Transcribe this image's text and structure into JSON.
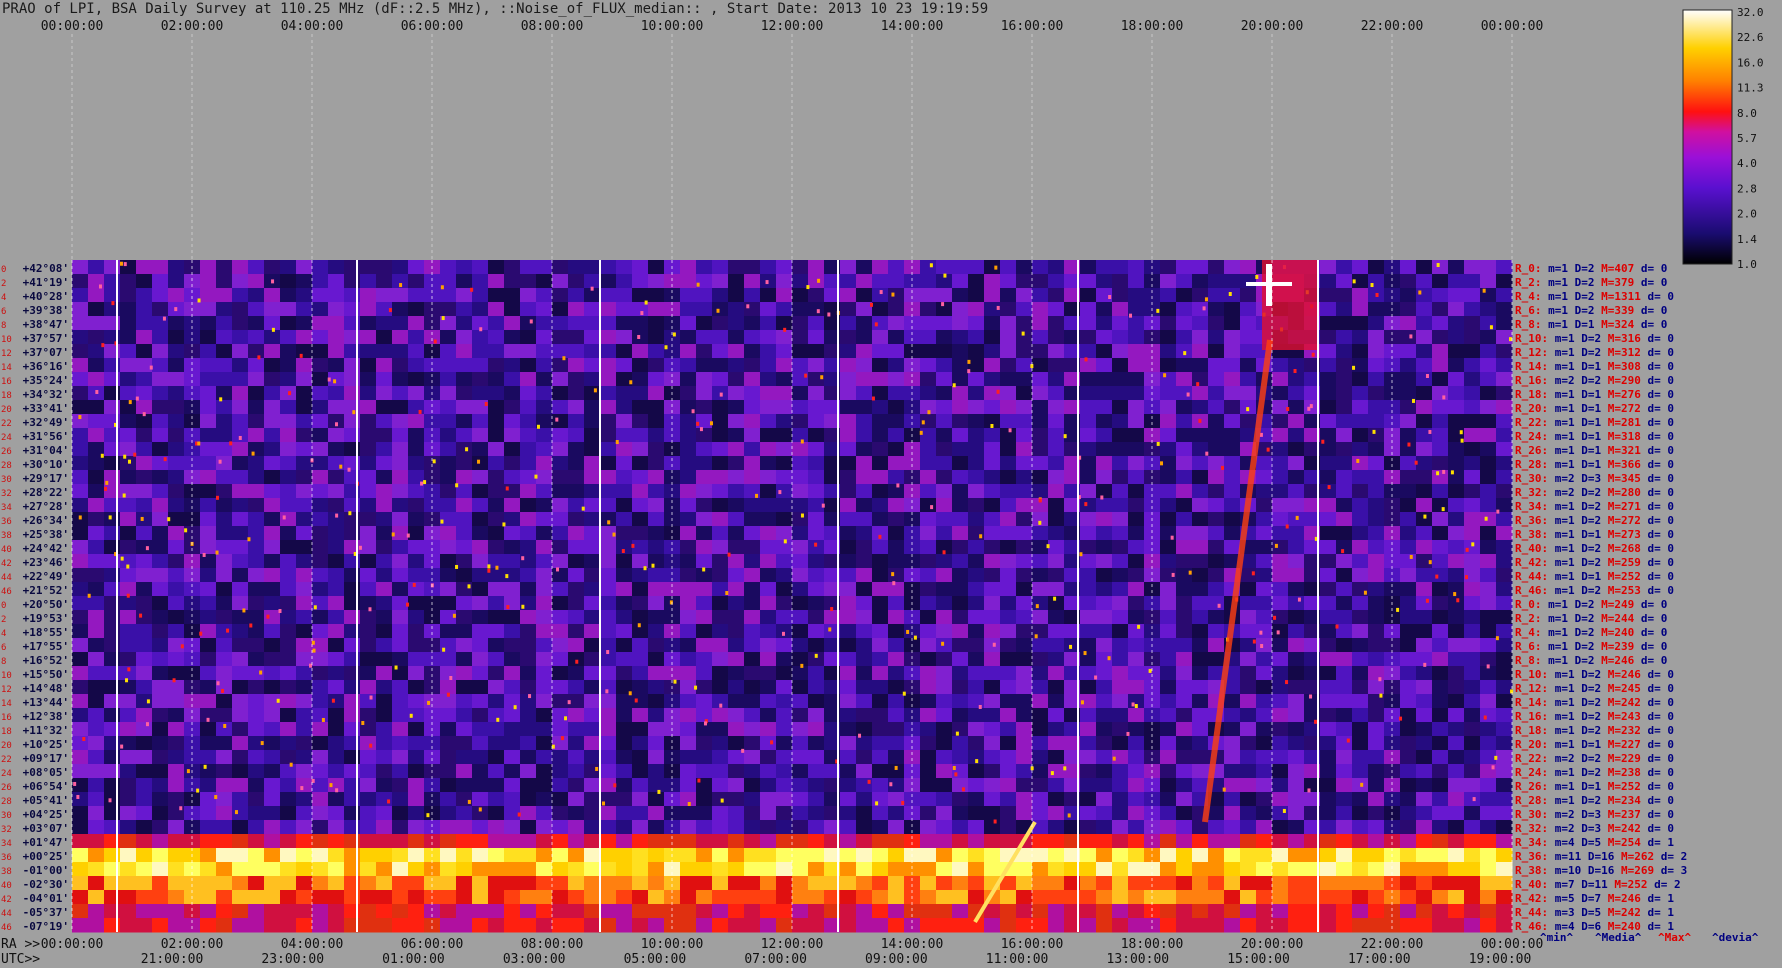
{
  "title": "PRAO of LPI, BSA Daily Survey at 110.25 MHz (dF::2.5 MHz), ::Noise_of_FLUX_median:: , Start Date: 2013 10 23 19:19:59",
  "colors": {
    "background": "#a0a0a0",
    "row_label_red": "#dd0000",
    "row_label_blue": "#000080"
  },
  "chart_data": {
    "type": "heatmap",
    "top_axis_ticks": [
      "00:00:00",
      "02:00:00",
      "04:00:00",
      "06:00:00",
      "08:00:00",
      "10:00:00",
      "12:00:00",
      "14:00:00",
      "16:00:00",
      "18:00:00",
      "20:00:00",
      "22:00:00",
      "00:00:00"
    ],
    "ra_axis": {
      "label": "RA >>",
      "ticks": [
        "00:00:00",
        "02:00:00",
        "04:00:00",
        "06:00:00",
        "08:00:00",
        "10:00:00",
        "12:00:00",
        "14:00:00",
        "16:00:00",
        "18:00:00",
        "20:00:00",
        "22:00:00",
        "00:00:00"
      ]
    },
    "utc_axis": {
      "label": "UTC>>",
      "ticks": [
        "21:00:00",
        "23:00:00",
        "01:00:00",
        "03:00:00",
        "05:00:00",
        "07:00:00",
        "09:00:00",
        "11:00:00",
        "13:00:00",
        "15:00:00",
        "17:00:00",
        "19:00:00"
      ]
    },
    "colorbar": {
      "ticks": [
        "32.0",
        "22.6",
        "16.0",
        "11.3",
        "8.0",
        "5.7",
        "4.0",
        "2.8",
        "2.0",
        "1.4",
        "1.0"
      ]
    },
    "footer_labels": [
      "^min^",
      "^Media^",
      "^Max^",
      "^devia^"
    ],
    "rows": [
      {
        "idx": "0",
        "dec": "+42°08'",
        "rlabel": "R_0:",
        "m": "1",
        "D": "2",
        "M": "407",
        "d": "0"
      },
      {
        "idx": "2",
        "dec": "+41°19'",
        "rlabel": "R_2:",
        "m": "1",
        "D": "2",
        "M": "379",
        "d": "0"
      },
      {
        "idx": "4",
        "dec": "+40°28'",
        "rlabel": "R_4:",
        "m": "1",
        "D": "2",
        "M": "1311",
        "d": "0"
      },
      {
        "idx": "6",
        "dec": "+39°38'",
        "rlabel": "R_6:",
        "m": "1",
        "D": "2",
        "M": "339",
        "d": "0"
      },
      {
        "idx": "8",
        "dec": "+38°47'",
        "rlabel": "R_8:",
        "m": "1",
        "D": "1",
        "M": "324",
        "d": "0"
      },
      {
        "idx": "10",
        "dec": "+37°57'",
        "rlabel": "R_10:",
        "m": "1",
        "D": "2",
        "M": "316",
        "d": "0"
      },
      {
        "idx": "12",
        "dec": "+37°07'",
        "rlabel": "R_12:",
        "m": "1",
        "D": "2",
        "M": "312",
        "d": "0"
      },
      {
        "idx": "14",
        "dec": "+36°16'",
        "rlabel": "R_14:",
        "m": "1",
        "D": "1",
        "M": "308",
        "d": "0"
      },
      {
        "idx": "16",
        "dec": "+35°24'",
        "rlabel": "R_16:",
        "m": "2",
        "D": "2",
        "M": "290",
        "d": "0"
      },
      {
        "idx": "18",
        "dec": "+34°32'",
        "rlabel": "R_18:",
        "m": "1",
        "D": "1",
        "M": "276",
        "d": "0"
      },
      {
        "idx": "20",
        "dec": "+33°41'",
        "rlabel": "R_20:",
        "m": "1",
        "D": "1",
        "M": "272",
        "d": "0"
      },
      {
        "idx": "22",
        "dec": "+32°49'",
        "rlabel": "R_22:",
        "m": "1",
        "D": "1",
        "M": "281",
        "d": "0"
      },
      {
        "idx": "24",
        "dec": "+31°56'",
        "rlabel": "R_24:",
        "m": "1",
        "D": "1",
        "M": "318",
        "d": "0"
      },
      {
        "idx": "26",
        "dec": "+31°04'",
        "rlabel": "R_26:",
        "m": "1",
        "D": "1",
        "M": "321",
        "d": "0"
      },
      {
        "idx": "28",
        "dec": "+30°10'",
        "rlabel": "R_28:",
        "m": "1",
        "D": "1",
        "M": "366",
        "d": "0"
      },
      {
        "idx": "30",
        "dec": "+29°17'",
        "rlabel": "R_30:",
        "m": "2",
        "D": "3",
        "M": "345",
        "d": "0"
      },
      {
        "idx": "32",
        "dec": "+28°22'",
        "rlabel": "R_32:",
        "m": "2",
        "D": "2",
        "M": "280",
        "d": "0"
      },
      {
        "idx": "34",
        "dec": "+27°28'",
        "rlabel": "R_34:",
        "m": "1",
        "D": "2",
        "M": "271",
        "d": "0"
      },
      {
        "idx": "36",
        "dec": "+26°34'",
        "rlabel": "R_36:",
        "m": "1",
        "D": "2",
        "M": "272",
        "d": "0"
      },
      {
        "idx": "38",
        "dec": "+25°38'",
        "rlabel": "R_38:",
        "m": "1",
        "D": "1",
        "M": "273",
        "d": "0"
      },
      {
        "idx": "40",
        "dec": "+24°42'",
        "rlabel": "R_40:",
        "m": "1",
        "D": "2",
        "M": "268",
        "d": "0"
      },
      {
        "idx": "42",
        "dec": "+23°46'",
        "rlabel": "R_42:",
        "m": "1",
        "D": "2",
        "M": "259",
        "d": "0"
      },
      {
        "idx": "44",
        "dec": "+22°49'",
        "rlabel": "R_44:",
        "m": "1",
        "D": "1",
        "M": "252",
        "d": "0"
      },
      {
        "idx": "46",
        "dec": "+21°52'",
        "rlabel": "R_46:",
        "m": "1",
        "D": "2",
        "M": "253",
        "d": "0"
      },
      {
        "idx": "0",
        "dec": "+20°50'",
        "rlabel": "R_0:",
        "m": "1",
        "D": "2",
        "M": "249",
        "d": "0"
      },
      {
        "idx": "2",
        "dec": "+19°53'",
        "rlabel": "R_2:",
        "m": "1",
        "D": "2",
        "M": "244",
        "d": "0"
      },
      {
        "idx": "4",
        "dec": "+18°55'",
        "rlabel": "R_4:",
        "m": "1",
        "D": "2",
        "M": "240",
        "d": "0"
      },
      {
        "idx": "6",
        "dec": "+17°55'",
        "rlabel": "R_6:",
        "m": "1",
        "D": "2",
        "M": "239",
        "d": "0"
      },
      {
        "idx": "8",
        "dec": "+16°52'",
        "rlabel": "R_8:",
        "m": "1",
        "D": "2",
        "M": "246",
        "d": "0"
      },
      {
        "idx": "10",
        "dec": "+15°50'",
        "rlabel": "R_10:",
        "m": "1",
        "D": "2",
        "M": "246",
        "d": "0"
      },
      {
        "idx": "12",
        "dec": "+14°48'",
        "rlabel": "R_12:",
        "m": "1",
        "D": "2",
        "M": "245",
        "d": "0"
      },
      {
        "idx": "14",
        "dec": "+13°44'",
        "rlabel": "R_14:",
        "m": "1",
        "D": "2",
        "M": "242",
        "d": "0"
      },
      {
        "idx": "16",
        "dec": "+12°38'",
        "rlabel": "R_16:",
        "m": "1",
        "D": "2",
        "M": "243",
        "d": "0"
      },
      {
        "idx": "18",
        "dec": "+11°32'",
        "rlabel": "R_18:",
        "m": "1",
        "D": "2",
        "M": "232",
        "d": "0"
      },
      {
        "idx": "20",
        "dec": "+10°25'",
        "rlabel": "R_20:",
        "m": "1",
        "D": "1",
        "M": "227",
        "d": "0"
      },
      {
        "idx": "22",
        "dec": "+09°17'",
        "rlabel": "R_22:",
        "m": "2",
        "D": "2",
        "M": "229",
        "d": "0"
      },
      {
        "idx": "24",
        "dec": "+08°05'",
        "rlabel": "R_24:",
        "m": "1",
        "D": "2",
        "M": "238",
        "d": "0"
      },
      {
        "idx": "26",
        "dec": "+06°54'",
        "rlabel": "R_26:",
        "m": "1",
        "D": "1",
        "M": "252",
        "d": "0"
      },
      {
        "idx": "28",
        "dec": "+05°41'",
        "rlabel": "R_28:",
        "m": "1",
        "D": "2",
        "M": "234",
        "d": "0"
      },
      {
        "idx": "30",
        "dec": "+04°25'",
        "rlabel": "R_30:",
        "m": "2",
        "D": "3",
        "M": "237",
        "d": "0"
      },
      {
        "idx": "32",
        "dec": "+03°07'",
        "rlabel": "R_32:",
        "m": "2",
        "D": "3",
        "M": "242",
        "d": "0"
      },
      {
        "idx": "34",
        "dec": "+01°47'",
        "rlabel": "R_34:",
        "m": "4",
        "D": "5",
        "M": "254",
        "d": "1"
      },
      {
        "idx": "36",
        "dec": "+00°25'",
        "rlabel": "R_36:",
        "m": "11",
        "D": "16",
        "M": "262",
        "d": "2"
      },
      {
        "idx": "38",
        "dec": "-01°00'",
        "rlabel": "R_38:",
        "m": "10",
        "D": "16",
        "M": "269",
        "d": "3"
      },
      {
        "idx": "40",
        "dec": "-02°30'",
        "rlabel": "R_40:",
        "m": "7",
        "D": "11",
        "M": "252",
        "d": "2"
      },
      {
        "idx": "42",
        "dec": "-04°01'",
        "rlabel": "R_42:",
        "m": "5",
        "D": "7",
        "M": "246",
        "d": "1"
      },
      {
        "idx": "44",
        "dec": "-05°37'",
        "rlabel": "R_44:",
        "m": "3",
        "D": "5",
        "M": "242",
        "d": "1"
      },
      {
        "idx": "46",
        "dec": "-07°19'",
        "rlabel": "R_46:",
        "m": "4",
        "D": "6",
        "M": "240",
        "d": "1"
      }
    ]
  }
}
